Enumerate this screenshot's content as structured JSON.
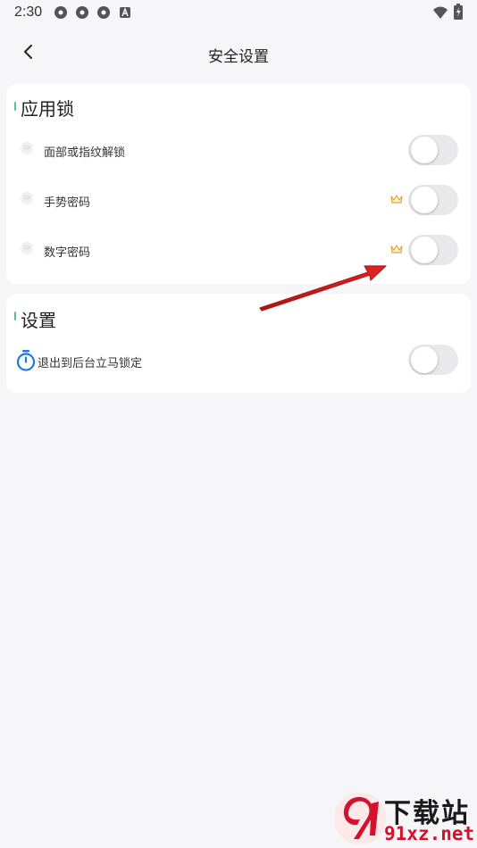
{
  "status_bar": {
    "time": "2:30",
    "icons": [
      "app-circle-icon",
      "app-circle-icon",
      "app-circle-icon",
      "a-notification-icon",
      "wifi-icon",
      "battery-charging-icon"
    ]
  },
  "app_bar": {
    "title": "安全设置",
    "back_icon": "chevron-left-icon"
  },
  "app_lock_section": {
    "title": "应用锁",
    "items": [
      {
        "label": "面部或指纹解锁",
        "icon": "fingerprint-icon",
        "premium": false,
        "enabled": false
      },
      {
        "label": "手势密码",
        "icon": "fingerprint-icon",
        "premium": true,
        "enabled": false
      },
      {
        "label": "数字密码",
        "icon": "fingerprint-icon",
        "premium": true,
        "enabled": false
      }
    ]
  },
  "settings_section": {
    "title": "设置",
    "items": [
      {
        "label": "退出到后台立马锁定",
        "icon": "stopwatch-icon",
        "enabled": false
      }
    ]
  },
  "colors": {
    "background": "#f6f6f8",
    "card": "#ffffff",
    "accent_green": "#53c28b",
    "toggle_off": "#e9e9ec",
    "stopwatch_blue": "#1f7ae0",
    "crown_gold": "#e6a23c",
    "annotation_arrow": "#d81f1f"
  },
  "watermark": {
    "title": "下载站",
    "domain": "91xz.net"
  }
}
